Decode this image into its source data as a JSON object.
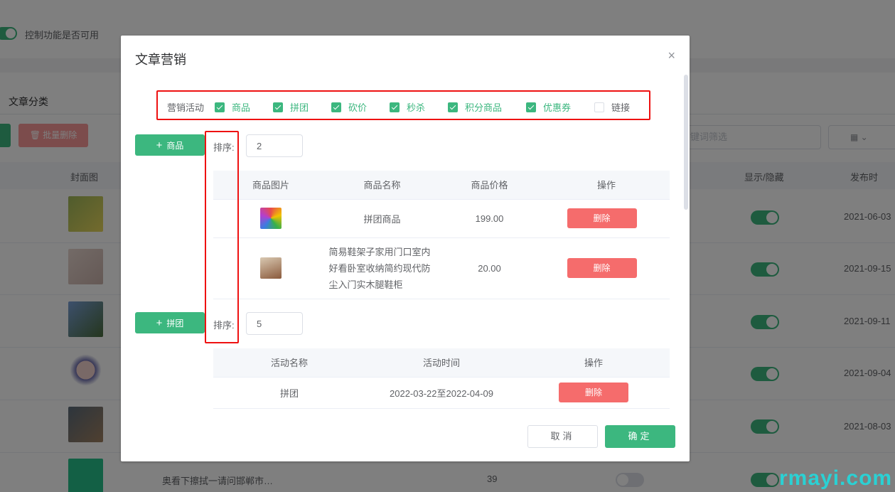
{
  "background": {
    "toggle_label": "控制功能是否可用",
    "category_tab": "文章分类",
    "batch_delete": "批量删除",
    "search_placeholder": "键词筛选",
    "columns": {
      "cover": "封面图",
      "visible": "显示/隐藏",
      "publish": "发布时"
    },
    "dates": [
      "2021-06-03",
      "2021-09-15",
      "2021-09-11",
      "2021-09-04",
      "2021-08-03"
    ],
    "last_row_title": "奥看下擦拭一请问邯郸市…",
    "last_row_num": "39",
    "watermark": "rmayi.com"
  },
  "dialog": {
    "title": "文章营销",
    "close_glyph": "×",
    "activity_label": "营销活动",
    "activities": [
      {
        "label": "商品",
        "checked": true
      },
      {
        "label": "拼团",
        "checked": true
      },
      {
        "label": "砍价",
        "checked": true
      },
      {
        "label": "秒杀",
        "checked": true
      },
      {
        "label": "积分商品",
        "checked": true
      },
      {
        "label": "优惠券",
        "checked": true
      },
      {
        "label": "链接",
        "checked": false
      }
    ],
    "goods": {
      "add_label": "商品",
      "sort_label": "排序:",
      "sort_value": "2",
      "headers": [
        "商品图片",
        "商品名称",
        "商品价格",
        "操作"
      ],
      "rows": [
        {
          "name": "拼团商品",
          "price": "199.00",
          "action": "删除"
        },
        {
          "name": "简易鞋架子家用门口室内好看卧室收纳简约现代防尘入门实木腿鞋柜",
          "price": "20.00",
          "action": "删除"
        }
      ]
    },
    "group": {
      "add_label": "拼团",
      "sort_label": "排序:",
      "sort_value": "5",
      "headers": [
        "活动名称",
        "活动时间",
        "操作"
      ],
      "rows": [
        {
          "name": "拼团",
          "time": "2022-03-22至2022-04-09",
          "action": "删除"
        }
      ]
    },
    "cancel_label": "取消",
    "confirm_label": "确定"
  }
}
